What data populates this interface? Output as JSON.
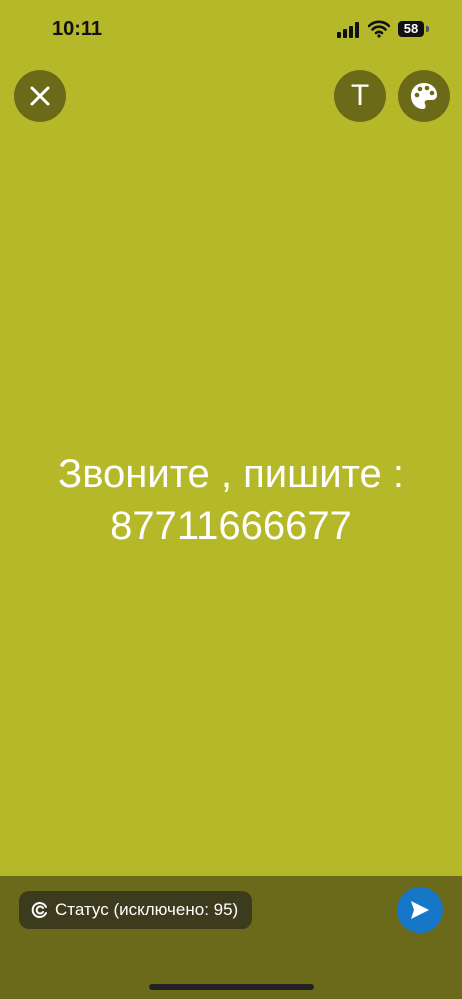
{
  "status_bar": {
    "time": "10:11",
    "battery": "58",
    "icons": [
      "signal-icon",
      "wifi-icon",
      "battery-icon"
    ]
  },
  "toolbar": {
    "close_icon": "close-icon",
    "text_tool_label": "T",
    "palette_icon": "palette-icon"
  },
  "story": {
    "background_color": "#b5b828",
    "text_color": "#ffffff",
    "lines": [
      "Звоните , пишите :",
      "87711666677"
    ]
  },
  "footer": {
    "status_label": "Статус (исключено: 95)",
    "status_icon": "status-ring-icon",
    "send_icon": "send-icon",
    "send_color": "#1677c9"
  }
}
